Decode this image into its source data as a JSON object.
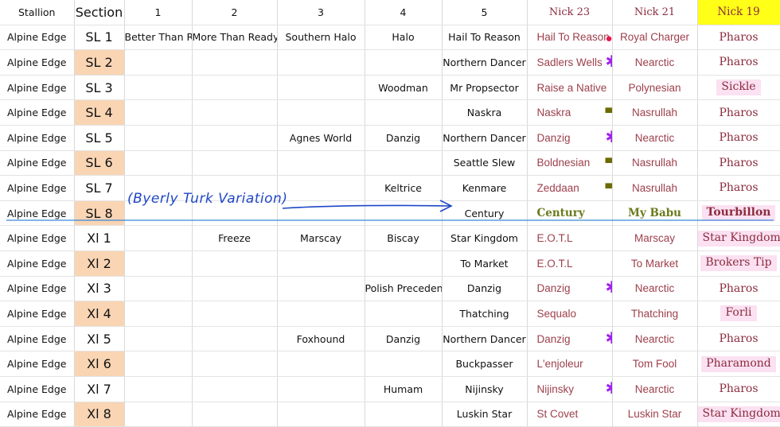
{
  "headers": [
    "Stallion",
    "Section",
    "1",
    "2",
    "3",
    "4",
    "5",
    "Nick 23",
    "Nick 21",
    "Nick 19"
  ],
  "rows": [
    {
      "stallion": "Alpine Edge",
      "section": "SL 1",
      "c1": "Better Than Ready",
      "c2": "More Than Ready",
      "c3": "Southern Halo",
      "c4": "Halo",
      "c5": "Hail To Reason",
      "n23": "Hail To Reason",
      "n21": "Royal Charger",
      "n19": "Pharos",
      "mark": "dot",
      "peach": false,
      "hl": false
    },
    {
      "stallion": "Alpine Edge",
      "section": "SL 2",
      "c1": "",
      "c2": "",
      "c3": "",
      "c4": "",
      "c5": "Northern Dancer",
      "n23": "Sadlers Wells",
      "n21": "Nearctic",
      "n19": "Pharos",
      "mark": "star",
      "peach": true,
      "hl": false
    },
    {
      "stallion": "Alpine Edge",
      "section": "SL 3",
      "c1": "",
      "c2": "",
      "c3": "",
      "c4": "Woodman",
      "c5": "Mr Propsector",
      "n23": "Raise a Native",
      "n21": "Polynesian",
      "n19": "Sickle",
      "mark": "",
      "peach": false,
      "hl": true
    },
    {
      "stallion": "Alpine Edge",
      "section": "SL 4",
      "c1": "",
      "c2": "",
      "c3": "",
      "c4": "",
      "c5": "Naskra",
      "n23": "Naskra",
      "n21": "Nasrullah",
      "n19": "Pharos",
      "mark": "dash",
      "peach": true,
      "hl": false
    },
    {
      "stallion": "Alpine Edge",
      "section": "SL 5",
      "c1": "",
      "c2": "",
      "c3": "Agnes World",
      "c4": "Danzig",
      "c5": "Northern Dancer",
      "n23": "Danzig",
      "n21": "Nearctic",
      "n19": "Pharos",
      "mark": "star",
      "peach": false,
      "hl": false
    },
    {
      "stallion": "Alpine Edge",
      "section": "SL 6",
      "c1": "",
      "c2": "",
      "c3": "",
      "c4": "",
      "c5": "Seattle Slew",
      "n23": "Boldnesian",
      "n21": "Nasrullah",
      "n19": "Pharos",
      "mark": "dash",
      "peach": true,
      "hl": false
    },
    {
      "stallion": "Alpine Edge",
      "section": "SL 7",
      "c1": "",
      "c2": "",
      "c3": "",
      "c4": "Keltrice",
      "c5": "Kenmare",
      "n23": "Zeddaan",
      "n21": "Nasrullah",
      "n19": "Pharos",
      "mark": "dash",
      "peach": false,
      "hl": false
    },
    {
      "stallion": "Alpine Edge",
      "section": "SL 8",
      "c1": "",
      "c2": "",
      "c3": "",
      "c4": "",
      "c5": "Century",
      "n23": "Century",
      "n21": "My Babu",
      "n19": "Tourbillon",
      "mark": "",
      "peach": true,
      "hl": true,
      "green": true
    },
    {
      "stallion": "Alpine Edge",
      "section": "Xl 1",
      "c1": "",
      "c2": "Freeze",
      "c3": "Marscay",
      "c4": "Biscay",
      "c5": "Star Kingdom",
      "n23": "E.O.T.L",
      "n21": "Marscay",
      "n19": "Star Kingdom",
      "mark": "",
      "peach": false,
      "hl": true
    },
    {
      "stallion": "Alpine Edge",
      "section": "Xl 2",
      "c1": "",
      "c2": "",
      "c3": "",
      "c4": "",
      "c5": "To Market",
      "n23": "E.O.T.L",
      "n21": "To Market",
      "n19": "Brokers Tip",
      "mark": "",
      "peach": true,
      "hl": true
    },
    {
      "stallion": "Alpine Edge",
      "section": "Xl 3",
      "c1": "",
      "c2": "",
      "c3": "",
      "c4": "Polish Precedent",
      "c5": "Danzig",
      "n23": "Danzig",
      "n21": "Nearctic",
      "n19": "Pharos",
      "mark": "star",
      "peach": false,
      "hl": false
    },
    {
      "stallion": "Alpine Edge",
      "section": "Xl 4",
      "c1": "",
      "c2": "",
      "c3": "",
      "c4": "",
      "c5": "Thatching",
      "n23": "Sequalo",
      "n21": "Thatching",
      "n19": "Forli",
      "mark": "",
      "peach": true,
      "hl": true
    },
    {
      "stallion": "Alpine Edge",
      "section": "Xl 5",
      "c1": "",
      "c2": "",
      "c3": "Foxhound",
      "c4": "Danzig",
      "c5": "Northern Dancer",
      "n23": "Danzig",
      "n21": "Nearctic",
      "n19": "Pharos",
      "mark": "star",
      "peach": false,
      "hl": false
    },
    {
      "stallion": "Alpine Edge",
      "section": "Xl 6",
      "c1": "",
      "c2": "",
      "c3": "",
      "c4": "",
      "c5": "Buckpasser",
      "n23": "L'enjoleur",
      "n21": "Tom Fool",
      "n19": "Pharamond",
      "mark": "",
      "peach": true,
      "hl": true
    },
    {
      "stallion": "Alpine Edge",
      "section": "Xl 7",
      "c1": "",
      "c2": "",
      "c3": "",
      "c4": "Humam",
      "c5": "Nijinsky",
      "n23": "Nijinsky",
      "n21": "Nearctic",
      "n19": "Pharos",
      "mark": "star",
      "peach": false,
      "hl": false
    },
    {
      "stallion": "Alpine Edge",
      "section": "Xl 8",
      "c1": "",
      "c2": "",
      "c3": "",
      "c4": "",
      "c5": "Luskin Star",
      "n23": "St Covet",
      "n21": "Luskin Star",
      "n19": "Star Kingdom",
      "mark": "",
      "peach": true,
      "hl": true
    }
  ],
  "annotation": "(Byerly Turk Variation)",
  "colors": {
    "peach": "#f9d5b4",
    "nick19_header": "#ffff17",
    "highlight_pink": "#fbe1f2",
    "ink_blue": "#1f47c7",
    "star_purple": "#a020f0",
    "dash_olive": "#6b6b00",
    "dot_red": "#e8174a"
  },
  "marks": {
    "star": "✱",
    "dash": "▬",
    "dot": "●"
  }
}
